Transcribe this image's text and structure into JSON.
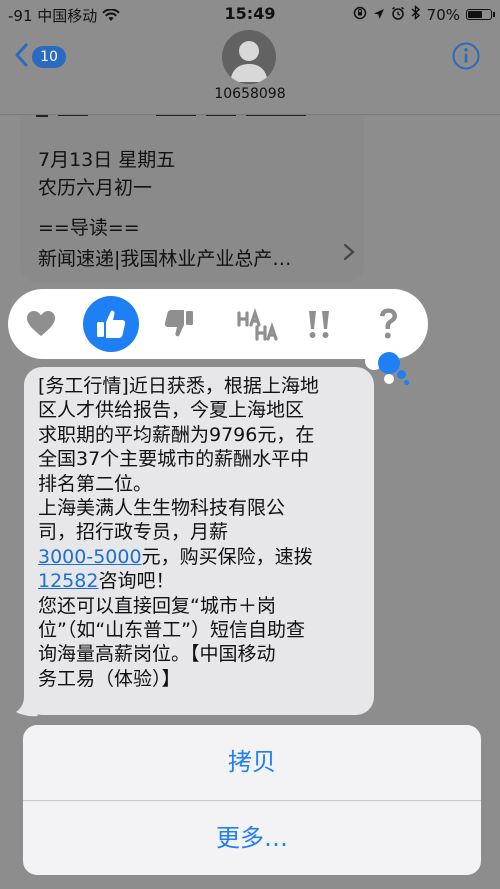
{
  "status_bar": {
    "signal": "-91",
    "carrier": "中国移动",
    "time": "15:49",
    "battery": "70%",
    "battery_level": 0.7
  },
  "nav": {
    "back_count": "10",
    "contact": "10658098"
  },
  "previous_message": {
    "lines": [
      "7月13日 星期五",
      "农历六月初一",
      "",
      "==导读==",
      "新闻速递|我国林业产业总产…"
    ]
  },
  "tapback": {
    "items": [
      {
        "icon": "heart-icon"
      },
      {
        "icon": "thumbs-up-icon",
        "selected": true
      },
      {
        "icon": "thumbs-down-icon"
      },
      {
        "icon": "haha-icon"
      },
      {
        "icon": "exclamation-icon"
      },
      {
        "icon": "question-icon"
      }
    ]
  },
  "message": {
    "line1": "[务工行情]近日获悉，根据上海地",
    "line2": "区人才供给报告，今夏上海地区",
    "line3": "求职期的平均薪酬为9796元，在",
    "line4": "全国37个主要城市的薪酬水平中",
    "line5": "排名第二位。",
    "line6": "上海美满人生生物科技有限公",
    "line7": "司，招行政专员，月薪",
    "salary_link": "3000-5000",
    "line8_rest": "元，购买保险，速拨",
    "phone_link": "12582",
    "line9_rest": "咨询吧！",
    "line10": "您还可以直接回复“城市＋岗",
    "line11": "位”（如“山东普工”）短信自助查",
    "line12": "询海量高薪岗位。【中国移动",
    "line13": "务工易（体验）】"
  },
  "action_sheet": {
    "copy_label": "拷贝",
    "more_label": "更多…"
  },
  "colors": {
    "accent": "#1f7ff5",
    "link": "#1f6fd6",
    "bubble": "#e7e7e9"
  }
}
